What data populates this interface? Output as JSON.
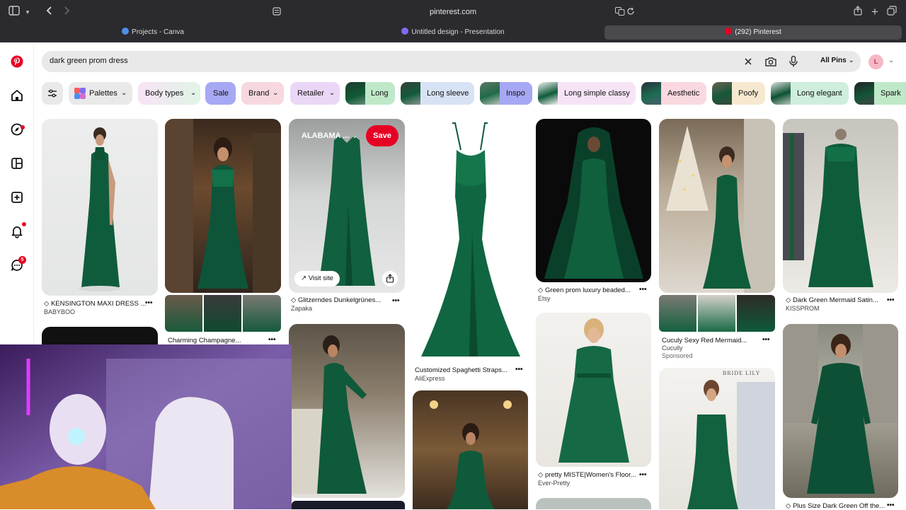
{
  "browser": {
    "url": "pinterest.com",
    "tabs": [
      {
        "label": "Projects - Canva"
      },
      {
        "label": "Untitled design - Presentation"
      },
      {
        "label": "(292) Pinterest"
      }
    ]
  },
  "search": {
    "query": "dark green prom dress",
    "scope": "All Pins",
    "avatar_letter": "L"
  },
  "sidebar": {
    "messages_badge": "5"
  },
  "filters": {
    "palettes": "Palettes",
    "body_types": "Body types",
    "sale": "Sale",
    "brand": "Brand",
    "retailer": "Retailer",
    "long": "Long",
    "long_sleeve": "Long sleeve",
    "inspo": "Inspo",
    "long_simple_classy": "Long simple classy",
    "aesthetic": "Aesthetic",
    "poofy": "Poofy",
    "long_elegant": "Long elegant",
    "sparkly": "Spark"
  },
  "hover_pin": {
    "board": "ALABAMA ...",
    "save": "Save",
    "visit": "Visit site"
  },
  "pins": [
    {
      "title": "KENSINGTON MAXI DRESS ...",
      "source": "BABYBOO"
    },
    {
      "title": "Charming Champagne..."
    },
    {
      "title": "Glitzerndes Dunkelgrünes...",
      "source": "Zapaka"
    },
    {
      "title": "Customized Spaghetti Straps...",
      "source": "AliExpress"
    },
    {
      "title": "Green prom luxury beaded...",
      "source": "Etsy"
    },
    {
      "title": "Cuculy Sexy Red Mermaid...",
      "source": "Cucully",
      "sponsored": "Sponsored"
    },
    {
      "title": "Dark Green Mermaid Satin...",
      "source": "KISSPROM"
    },
    {
      "title": "pretty MISTE|Women's Floor...",
      "source": "Ever-Pretty"
    },
    {
      "title": "Plus Size Dark Green Off the..."
    }
  ],
  "image_text": {
    "bride_lily": "BRIDE LILY"
  },
  "more_glyph": "•••",
  "colors": {
    "pinterest_red": "#e60023",
    "chrome_bg": "#2b2a2e"
  }
}
